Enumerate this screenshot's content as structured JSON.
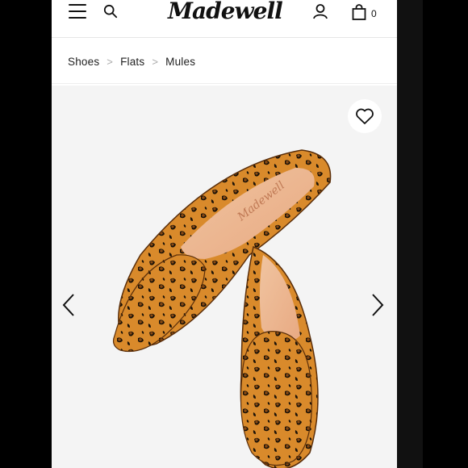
{
  "header": {
    "logo_text": "Madewell",
    "bag_count": "0",
    "icons": [
      "menu-icon",
      "search-icon",
      "account-icon",
      "bag-icon"
    ]
  },
  "breadcrumb": {
    "items": [
      "Shoes",
      "Flats",
      "Mules"
    ]
  },
  "gallery": {
    "icons": [
      "heart-icon",
      "chevron-left-icon",
      "chevron-right-icon"
    ],
    "insole_text": "Madewell",
    "colors": {
      "background": "#f4f4f4",
      "leopard_base": "#d98a2b"
    }
  }
}
